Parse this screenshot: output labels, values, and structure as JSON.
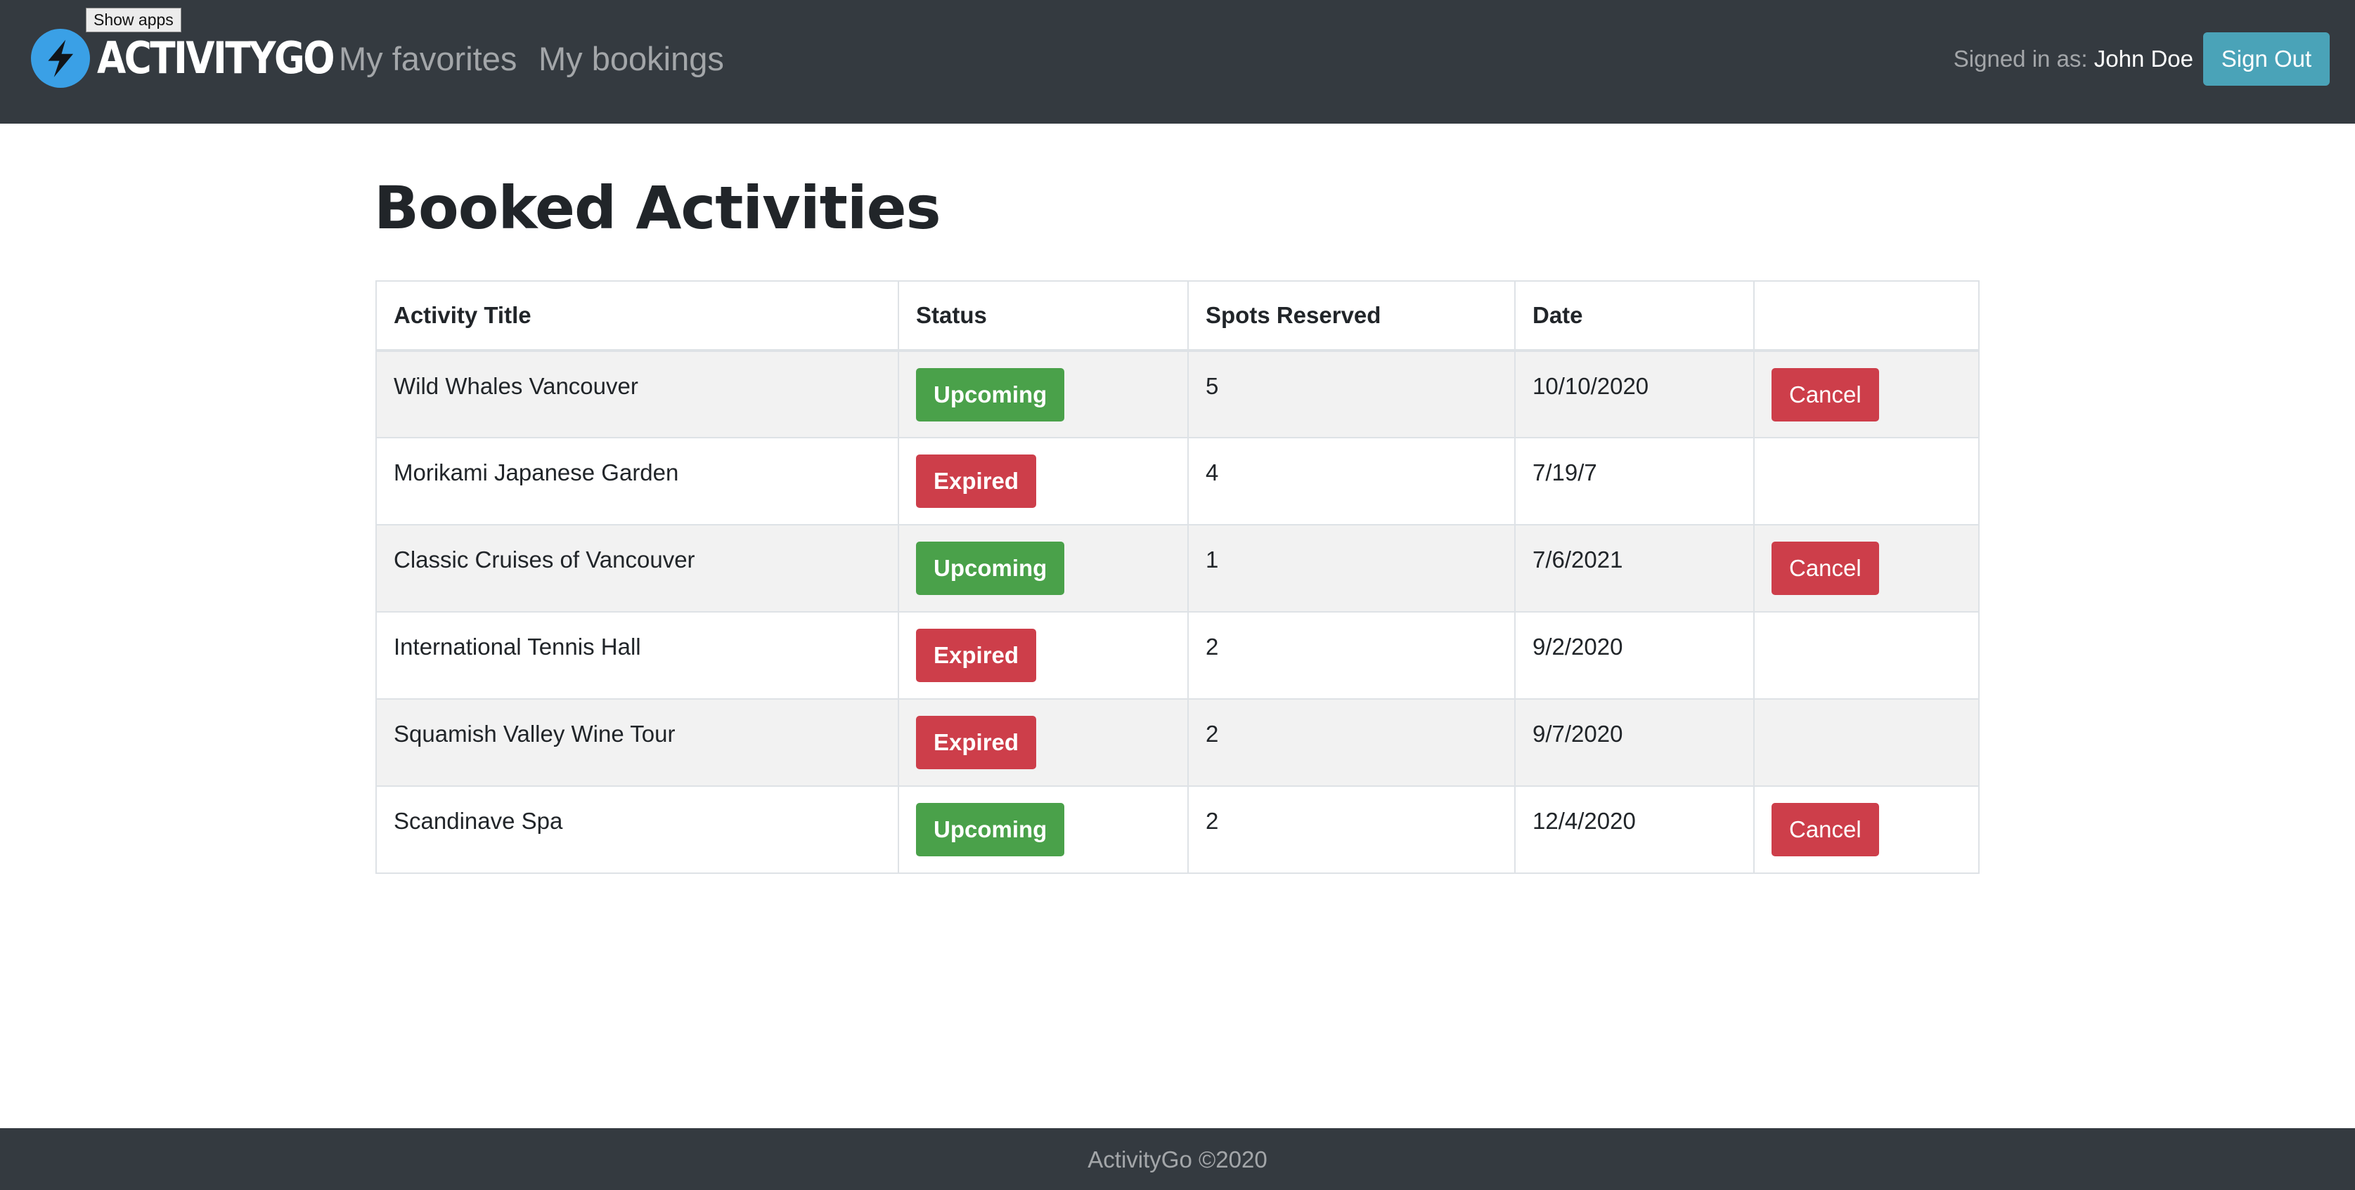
{
  "tooltip": {
    "text": "Show apps"
  },
  "header": {
    "logo_text": "ACTIVITYGO",
    "nav": {
      "favorites": "My favorites",
      "bookings": "My bookings"
    },
    "signed_in_label": "Signed in as: ",
    "user_name": "John Doe",
    "signout_label": "Sign Out"
  },
  "main": {
    "title": "Booked Activities",
    "table": {
      "headers": {
        "title": "Activity Title",
        "status": "Status",
        "spots": "Spots Reserved",
        "date": "Date",
        "action": ""
      },
      "rows": [
        {
          "title": "Wild Whales Vancouver",
          "status": "Upcoming",
          "spots": "5",
          "date": "10/10/2020",
          "action": "Cancel"
        },
        {
          "title": "Morikami Japanese Garden",
          "status": "Expired",
          "spots": "4",
          "date": "7/19/7",
          "action": ""
        },
        {
          "title": "Classic Cruises of Vancouver",
          "status": "Upcoming",
          "spots": "1",
          "date": "7/6/2021",
          "action": "Cancel"
        },
        {
          "title": "International Tennis Hall",
          "status": "Expired",
          "spots": "2",
          "date": "9/2/2020",
          "action": ""
        },
        {
          "title": "Squamish Valley Wine Tour",
          "status": "Expired",
          "spots": "2",
          "date": "9/7/2020",
          "action": ""
        },
        {
          "title": "Scandinave Spa",
          "status": "Upcoming",
          "spots": "2",
          "date": "12/4/2020",
          "action": "Cancel"
        }
      ]
    }
  },
  "footer": {
    "text": "ActivityGo ©2020"
  },
  "colors": {
    "navbar": "#343a40",
    "logo_badge": "#3aa0e6",
    "signout_button": "#4aa3b8",
    "upcoming_badge": "#4aa14a",
    "expired_badge": "#cd3e4a",
    "cancel_button": "#cd3e4a",
    "stripe": "#f2f2f2"
  },
  "icons": {
    "logo": "lightning-bolt-icon"
  }
}
